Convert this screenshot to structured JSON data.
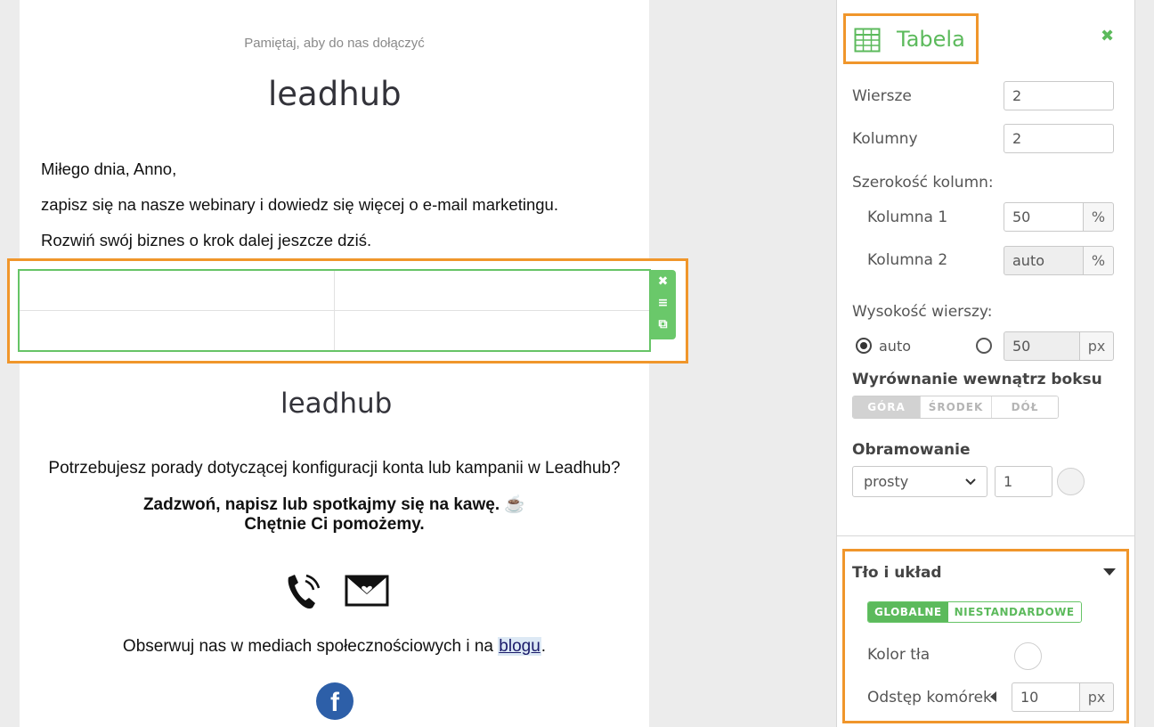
{
  "email": {
    "reminder": "Pamiętaj, aby do nas dołączyć",
    "logo_text": "leadhub",
    "greeting": "Miłego dnia, Anno,",
    "line2": "zapisz się na nasze webinary i dowiedz się więcej o e-mail marketingu.",
    "line3": "Rozwiń swój biznes o krok dalej jeszcze dziś.",
    "advice": "Potrzebujesz porady dotyczącej konfiguracji konta lub kampanii w Leadhub?",
    "call_line1": "Zadzwoń, napisz lub spotkajmy się na kawę. ☕",
    "call_line2": "Chętnie Ci pomożemy.",
    "social_prefix": "Obserwuj nas w mediach społecznościowych i na ",
    "social_link": "blogu",
    "social_suffix": ".",
    "facebook_letter": "f"
  },
  "table_block": {
    "rows": 2,
    "columns": 2,
    "tools": {
      "delete": "✖",
      "move": "≡",
      "duplicate": "⧉"
    }
  },
  "panel": {
    "title": "Tabela",
    "close": "✖",
    "rows_label": "Wiersze",
    "rows_value": "2",
    "cols_label": "Kolumny",
    "cols_value": "2",
    "col_width_label": "Szerokość kolumn:",
    "col1_label": "Kolumna 1",
    "col1_value": "50",
    "col1_unit": "%",
    "col2_label": "Kolumna 2",
    "col2_value": "auto",
    "col2_unit": "%",
    "row_height_label": "Wysokość wierszy:",
    "row_height_auto": "auto",
    "row_height_value": "50",
    "row_height_unit": "px",
    "align_label": "Wyrównanie wewnątrz boksu",
    "align_options": [
      "GÓRA",
      "ŚRODEK",
      "DÓŁ"
    ],
    "border_label": "Obramowanie",
    "border_style": "prosty",
    "border_width": "1",
    "bg_section_label": "Tło i układ",
    "bg_modes": [
      "GLOBALNE",
      "NIESTANDARDOWE"
    ],
    "bg_color_label": "Kolor tła",
    "spacing_label": "Odstęp komórek",
    "spacing_value": "10",
    "spacing_unit": "px"
  },
  "colors": {
    "accent_green": "#5cba5c",
    "highlight_orange": "#f0962b",
    "facebook_blue": "#2d5fa8"
  }
}
